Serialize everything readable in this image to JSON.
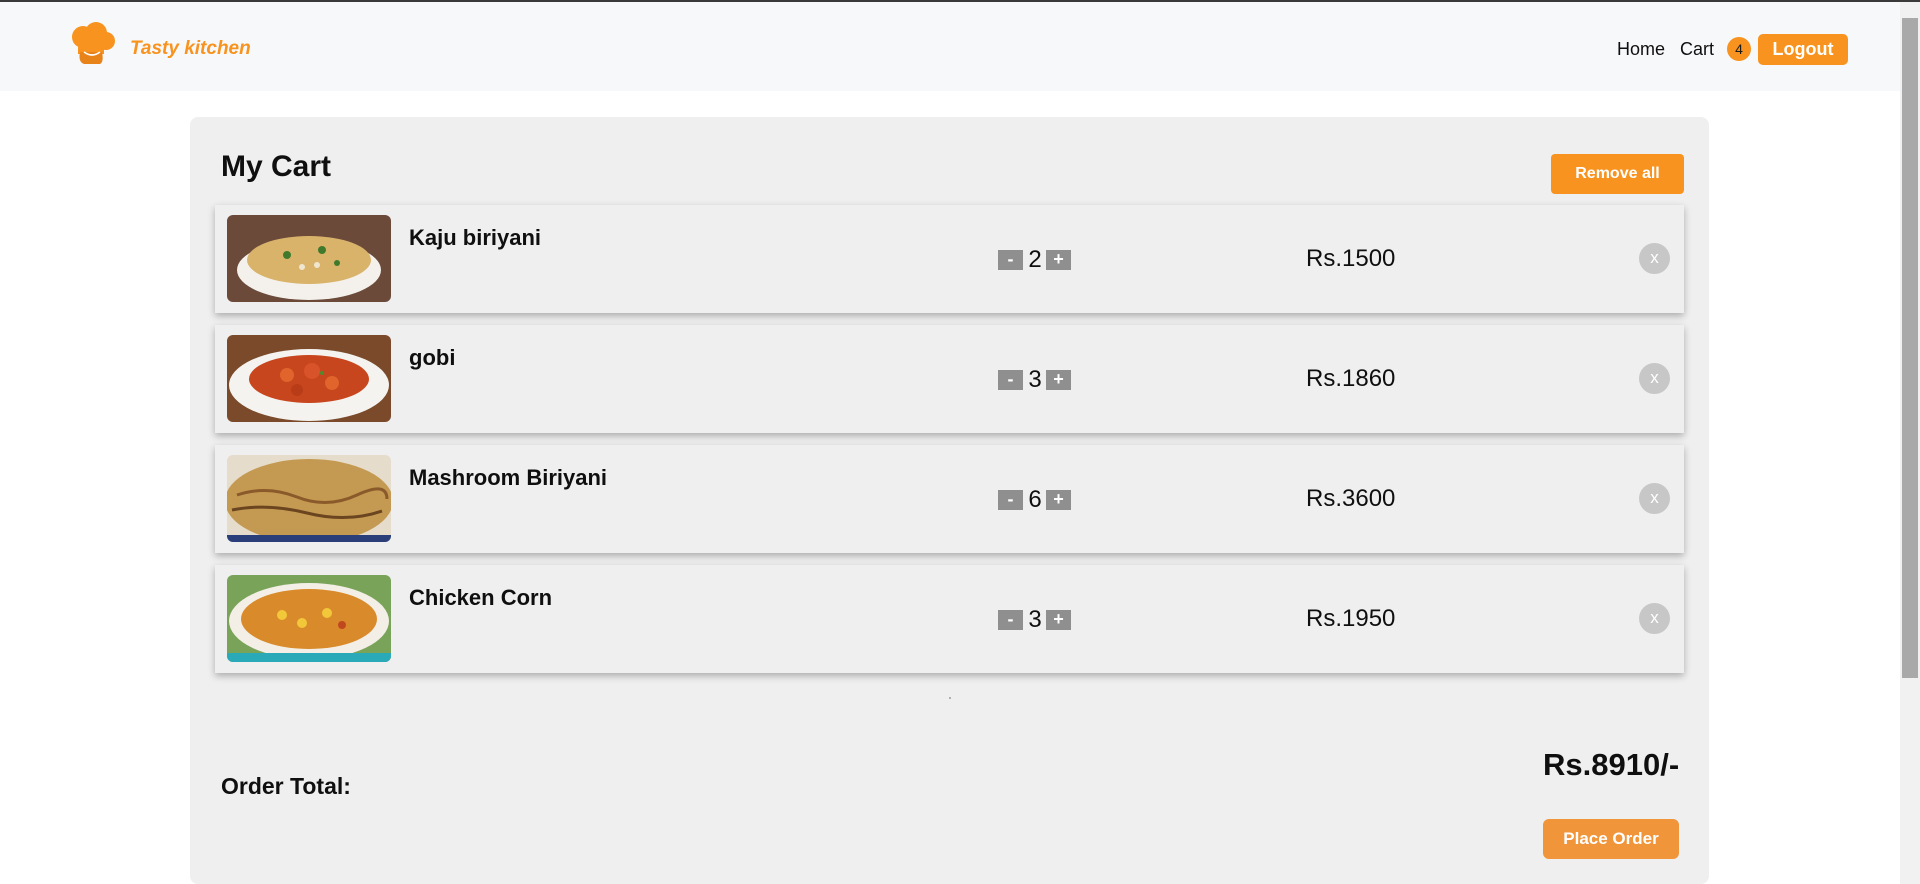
{
  "navbar": {
    "brand": "Tasty kitchen",
    "logo_icon": "chef-hat-icon",
    "links": {
      "home": "Home",
      "cart": "Cart"
    },
    "cart_count": "4",
    "logout": "Logout"
  },
  "cart": {
    "title": "My Cart",
    "remove_all": "Remove all",
    "items": [
      {
        "name": "Kaju biriyani",
        "qty": "2",
        "price": "Rs.1500",
        "minus": "-",
        "plus": "+",
        "remove": "x"
      },
      {
        "name": "gobi",
        "qty": "3",
        "price": "Rs.1860",
        "minus": "-",
        "plus": "+",
        "remove": "x"
      },
      {
        "name": "Mashroom Biriyani",
        "qty": "6",
        "price": "Rs.3600",
        "minus": "-",
        "plus": "+",
        "remove": "x"
      },
      {
        "name": "Chicken Corn",
        "qty": "3",
        "price": "Rs.1950",
        "minus": "-",
        "plus": "+",
        "remove": "x"
      }
    ],
    "order_total_label": "Order Total:",
    "order_total": "Rs.8910/-",
    "place_order": "Place Order"
  },
  "colors": {
    "accent": "#f7931e",
    "panel": "#efefef",
    "navbar_bg": "#f7f8fa"
  }
}
